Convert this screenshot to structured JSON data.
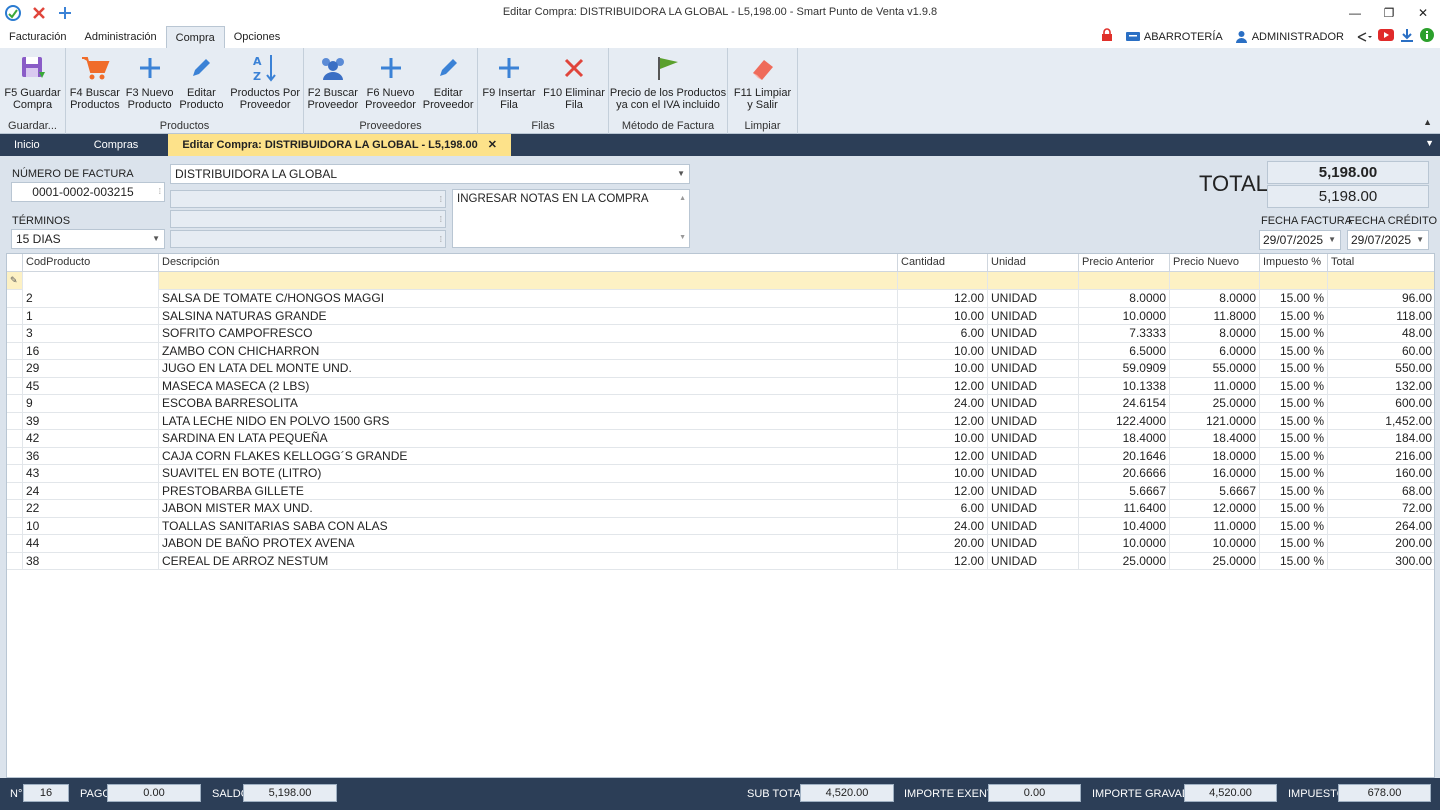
{
  "window": {
    "title": "Editar Compra: DISTRIBUIDORA LA GLOBAL - L5,198.00 - Smart Punto de Venta v1.9.8"
  },
  "menu": {
    "tabs": [
      "Facturación",
      "Administración",
      "Compra",
      "Opciones"
    ],
    "active": "Compra",
    "store_label": "ABARROTERÍA",
    "user_label": "ADMINISTRADOR"
  },
  "ribbon": {
    "groups": [
      {
        "label": "Guardar...",
        "buttons": [
          "F5 Guardar\nCompra"
        ]
      },
      {
        "label": "Productos",
        "buttons": [
          "F4 Buscar\nProductos",
          "F3 Nuevo\nProducto",
          "Editar\nProducto",
          "Productos Por\nProveedor"
        ]
      },
      {
        "label": "Proveedores",
        "buttons": [
          "F2 Buscar\nProveedor",
          "F6 Nuevo\nProveedor",
          "Editar\nProveedor"
        ]
      },
      {
        "label": "Filas",
        "buttons": [
          "F9 Insertar\nFila",
          "F10 Eliminar\nFila"
        ]
      },
      {
        "label": "Método de Factura",
        "buttons": [
          "Precio de los Productos\nya con el IVA incluido"
        ]
      },
      {
        "label": "Limpiar",
        "buttons": [
          "F11 Limpiar\ny Salir"
        ]
      }
    ]
  },
  "doctabs": {
    "inicio": "Inicio",
    "compras": "Compras",
    "active": "Editar Compra: DISTRIBUIDORA LA GLOBAL - L5,198.00"
  },
  "form": {
    "invoice_label": "NÚMERO DE FACTURA",
    "invoice_value": "0001-0002-003215",
    "supplier_value": "DISTRIBUIDORA LA GLOBAL",
    "terms_label": "TÉRMINOS",
    "terms_value": "15 DIAS",
    "notes_placeholder": "INGRESAR NOTAS EN LA COMPRA",
    "total_label": "TOTAL",
    "total_main": "5,198.00",
    "total_secondary": "5,198.00",
    "invoice_date_label": "FECHA FACTURA",
    "invoice_date": "29/07/2025",
    "credit_date_label": "FECHA CRÉDITO",
    "credit_date": "29/07/2025"
  },
  "grid": {
    "columns": [
      "CodProducto",
      "Descripción",
      "Cantidad",
      "Unidad",
      "Precio Anterior",
      "Precio Nuevo",
      "Impuesto %",
      "Total"
    ],
    "rows": [
      [
        "2",
        "SALSA DE TOMATE C/HONGOS MAGGI",
        "12.00",
        "UNIDAD",
        "8.0000",
        "8.0000",
        "15.00 %",
        "96.00"
      ],
      [
        "1",
        "SALSINA NATURAS GRANDE",
        "10.00",
        "UNIDAD",
        "10.0000",
        "11.8000",
        "15.00 %",
        "118.00"
      ],
      [
        "3",
        "SOFRITO CAMPOFRESCO",
        "6.00",
        "UNIDAD",
        "7.3333",
        "8.0000",
        "15.00 %",
        "48.00"
      ],
      [
        "16",
        "ZAMBO CON CHICHARRON",
        "10.00",
        "UNIDAD",
        "6.5000",
        "6.0000",
        "15.00 %",
        "60.00"
      ],
      [
        "29",
        "JUGO EN LATA DEL MONTE UND.",
        "10.00",
        "UNIDAD",
        "59.0909",
        "55.0000",
        "15.00 %",
        "550.00"
      ],
      [
        "45",
        "MASECA MASECA (2 LBS)",
        "12.00",
        "UNIDAD",
        "10.1338",
        "11.0000",
        "15.00 %",
        "132.00"
      ],
      [
        "9",
        "ESCOBA BARRESOLITA",
        "24.00",
        "UNIDAD",
        "24.6154",
        "25.0000",
        "15.00 %",
        "600.00"
      ],
      [
        "39",
        "LATA LECHE NIDO EN POLVO 1500 GRS",
        "12.00",
        "UNIDAD",
        "122.4000",
        "121.0000",
        "15.00 %",
        "1,452.00"
      ],
      [
        "42",
        "SARDINA EN LATA PEQUEÑA",
        "10.00",
        "UNIDAD",
        "18.4000",
        "18.4000",
        "15.00 %",
        "184.00"
      ],
      [
        "36",
        "CAJA CORN FLAKES KELLOGG´S GRANDE",
        "12.00",
        "UNIDAD",
        "20.1646",
        "18.0000",
        "15.00 %",
        "216.00"
      ],
      [
        "43",
        "SUAVITEL EN BOTE (LITRO)",
        "10.00",
        "UNIDAD",
        "20.6666",
        "16.0000",
        "15.00 %",
        "160.00"
      ],
      [
        "24",
        "PRESTOBARBA GILLETE",
        "12.00",
        "UNIDAD",
        "5.6667",
        "5.6667",
        "15.00 %",
        "68.00"
      ],
      [
        "22",
        "JABON MISTER MAX UND.",
        "6.00",
        "UNIDAD",
        "11.6400",
        "12.0000",
        "15.00 %",
        "72.00"
      ],
      [
        "10",
        "TOALLAS SANITARIAS SABA CON ALAS",
        "24.00",
        "UNIDAD",
        "10.4000",
        "11.0000",
        "15.00 %",
        "264.00"
      ],
      [
        "44",
        "JABON DE BAÑO PROTEX AVENA",
        "20.00",
        "UNIDAD",
        "10.0000",
        "10.0000",
        "15.00 %",
        "200.00"
      ],
      [
        "38",
        "CEREAL DE ARROZ NESTUM",
        "12.00",
        "UNIDAD",
        "25.0000",
        "25.0000",
        "15.00 %",
        "300.00"
      ]
    ]
  },
  "status": {
    "count_label": "N°",
    "count": "16",
    "pago_label": "PAGO",
    "pago": "0.00",
    "saldo_label": "SALDO",
    "saldo": "5,198.00",
    "subtotal_label": "SUB TOTAL",
    "subtotal": "4,520.00",
    "exento_label": "IMPORTE EXENTO",
    "exento": "0.00",
    "gravado_label": "IMPORTE GRAVADO",
    "gravado": "4,520.00",
    "impuesto_label": "IMPUESTO",
    "impuesto": "678.00"
  }
}
